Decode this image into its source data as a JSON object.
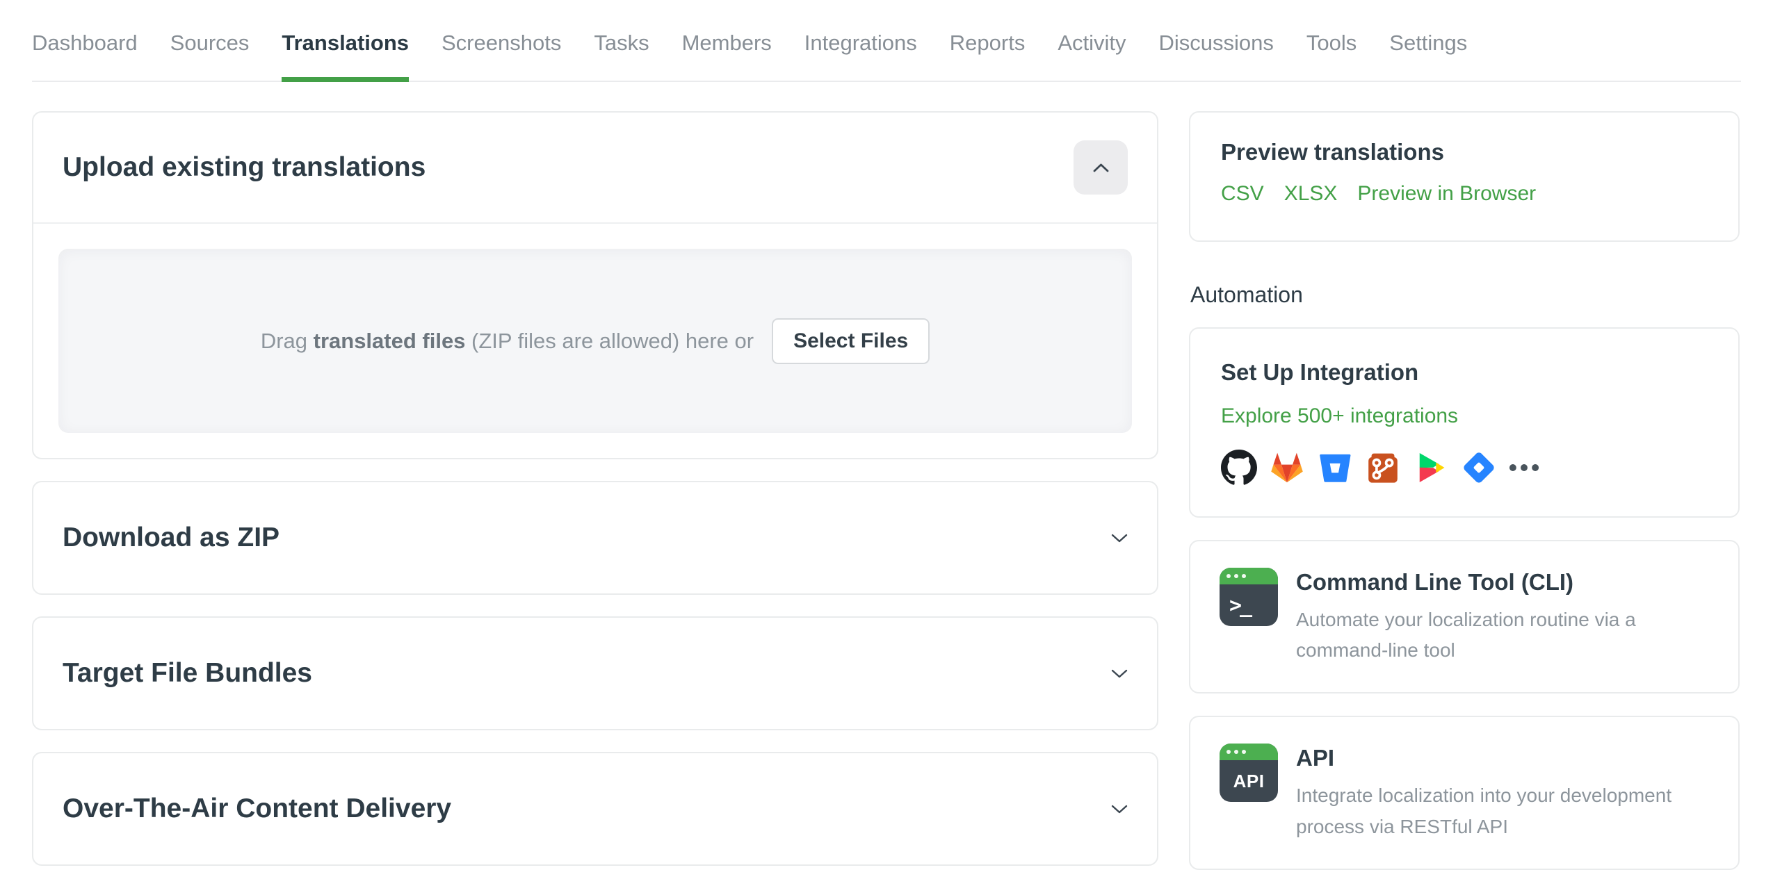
{
  "nav": {
    "items": [
      {
        "label": "Dashboard"
      },
      {
        "label": "Sources"
      },
      {
        "label": "Translations",
        "active": true
      },
      {
        "label": "Screenshots"
      },
      {
        "label": "Tasks"
      },
      {
        "label": "Members"
      },
      {
        "label": "Integrations"
      },
      {
        "label": "Reports"
      },
      {
        "label": "Activity"
      },
      {
        "label": "Discussions"
      },
      {
        "label": "Tools"
      },
      {
        "label": "Settings"
      }
    ]
  },
  "main": {
    "upload_card": {
      "title": "Upload existing translations",
      "dropzone": {
        "text_prefix": "Drag ",
        "text_bold": "translated files",
        "text_suffix": " (ZIP files are allowed) here or",
        "button_label": "Select Files"
      }
    },
    "collapsed_cards": [
      {
        "title": "Download as ZIP"
      },
      {
        "title": "Target File Bundles"
      },
      {
        "title": "Over-The-Air Content Delivery"
      }
    ]
  },
  "sidebar": {
    "preview_card": {
      "title": "Preview translations",
      "links": [
        {
          "label": "CSV"
        },
        {
          "label": "XLSX"
        },
        {
          "label": "Preview in Browser"
        }
      ]
    },
    "automation_heading": "Automation",
    "integration_card": {
      "title": "Set Up Integration",
      "link_label": "Explore 500+ integrations",
      "icons": [
        {
          "name": "github-icon"
        },
        {
          "name": "gitlab-icon"
        },
        {
          "name": "bitbucket-icon"
        },
        {
          "name": "git-icon"
        },
        {
          "name": "google-play-icon"
        },
        {
          "name": "jira-icon"
        },
        {
          "name": "more-integrations-icon"
        }
      ]
    },
    "cli_card": {
      "title": "Command Line Tool (CLI)",
      "description": "Automate your localization routine via a command-line tool",
      "icon_label": ">_"
    },
    "api_card": {
      "title": "API",
      "description": "Integrate localization into your development process via RESTful API",
      "icon_label": "API"
    }
  },
  "colors": {
    "accent_green": "#43a047",
    "dark_text": "#2e3c46",
    "muted_text": "#8d959c",
    "nav_inactive": "#878e95",
    "card_border": "#e9ebec",
    "terminal_body": "#3d4750",
    "terminal_bar": "#4caf50"
  }
}
